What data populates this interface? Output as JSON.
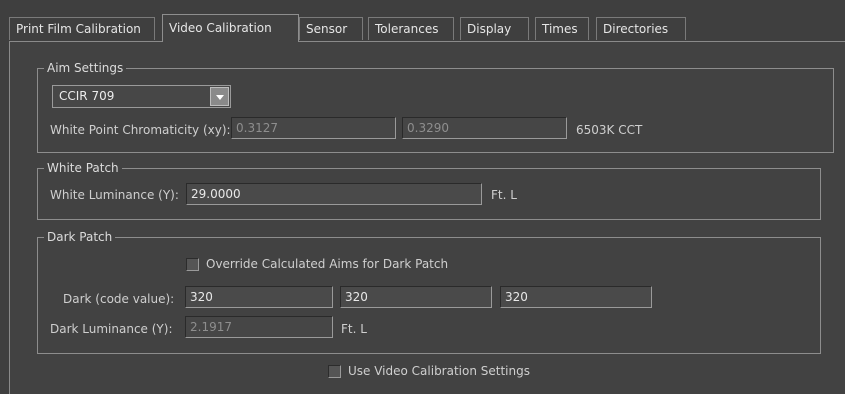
{
  "tabs": [
    {
      "label": "Print Film Calibration"
    },
    {
      "label": "Video Calibration"
    },
    {
      "label": "Sensor"
    },
    {
      "label": "Tolerances"
    },
    {
      "label": "Display"
    },
    {
      "label": "Times"
    },
    {
      "label": "Directories"
    }
  ],
  "aim_settings": {
    "title": "Aim Settings",
    "preset": "CCIR 709",
    "white_point_label": "White Point Chromaticity (xy):",
    "white_point_x": "0.3127",
    "white_point_y": "0.3290",
    "cct": "6503K CCT"
  },
  "white_patch": {
    "title": "White Patch",
    "luminance_label": "White Luminance (Y):",
    "luminance_value": "29.0000",
    "unit": "Ft. L"
  },
  "dark_patch": {
    "title": "Dark Patch",
    "override_label": "Override Calculated Aims for Dark Patch",
    "override_checked": false,
    "code_value_label": "Dark (code value):",
    "code_values": [
      "320",
      "320",
      "320"
    ],
    "luminance_label": "Dark Luminance (Y):",
    "luminance_value": "2.1917",
    "unit": "Ft. L"
  },
  "use_video_calibration": {
    "label": "Use Video Calibration Settings",
    "checked": false
  }
}
